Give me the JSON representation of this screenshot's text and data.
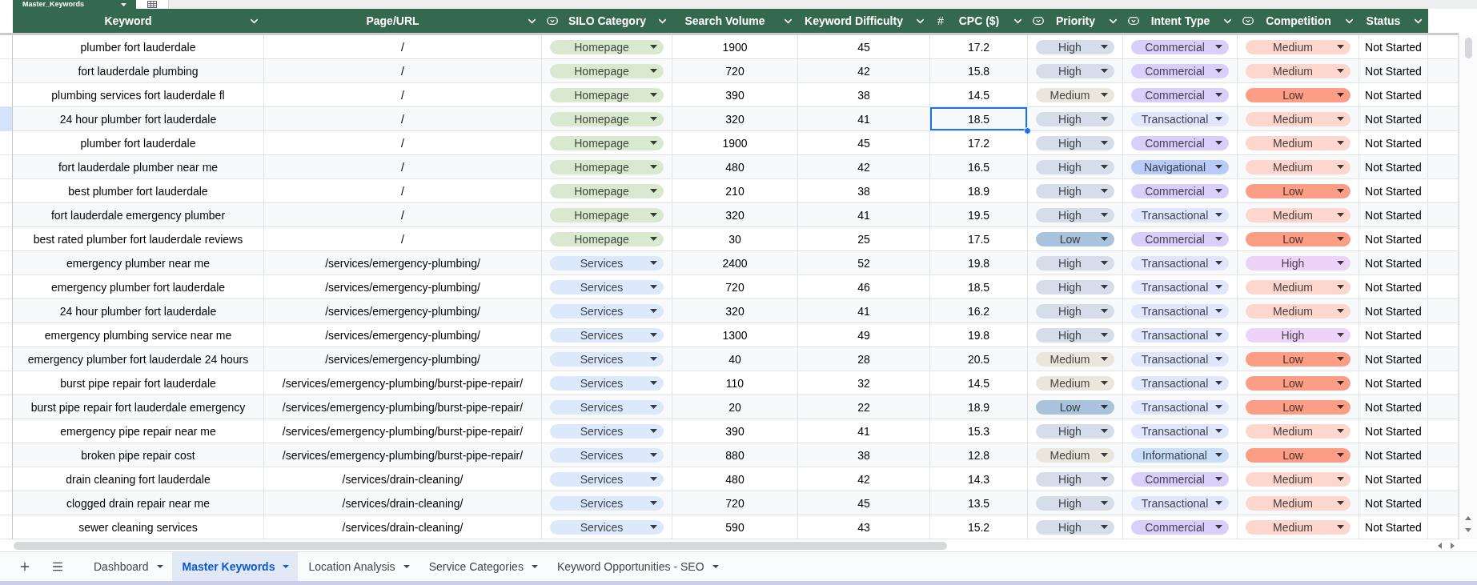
{
  "table_name": {
    "label": "Master_Keywords"
  },
  "columns": [
    {
      "label": "Keyword",
      "kind": "text",
      "selected": false
    },
    {
      "label": "Page/URL",
      "kind": "text",
      "selected": false
    },
    {
      "label": "SILO Category",
      "kind": "dropdown",
      "selected": false
    },
    {
      "label": "Search Volume",
      "kind": "text",
      "selected": false
    },
    {
      "label": "Keyword Difficulty",
      "kind": "text",
      "selected": false
    },
    {
      "label": "CPC ($)",
      "kind": "number",
      "symbol": "#",
      "selected": true
    },
    {
      "label": "Priority",
      "kind": "dropdown",
      "selected": false
    },
    {
      "label": "Intent Type",
      "kind": "dropdown",
      "selected": false
    },
    {
      "label": "Competition",
      "kind": "dropdown",
      "selected": false
    },
    {
      "label": "Status",
      "kind": "text",
      "selected": false
    }
  ],
  "rows": [
    {
      "selected": false,
      "cells": [
        "plumber fort lauderdale",
        "/",
        {
          "label": "Homepage",
          "color": "#d9e9cf"
        },
        "1900",
        "45",
        "17.2",
        {
          "label": "High",
          "color": "#d4dde9"
        },
        {
          "label": "Commercial",
          "color": "#d9cffb"
        },
        {
          "label": "Medium",
          "color": "#fdd6cd"
        },
        "Not Started"
      ]
    },
    {
      "selected": false,
      "cells": [
        "fort lauderdale plumbing",
        "/",
        {
          "label": "Homepage",
          "color": "#d9e9cf"
        },
        "720",
        "42",
        "15.8",
        {
          "label": "High",
          "color": "#d4dde9"
        },
        {
          "label": "Commercial",
          "color": "#d9cffb"
        },
        {
          "label": "Medium",
          "color": "#fdd6cd"
        },
        "Not Started"
      ]
    },
    {
      "selected": false,
      "cells": [
        "plumbing services fort lauderdale fl",
        "/",
        {
          "label": "Homepage",
          "color": "#d9e9cf"
        },
        "390",
        "38",
        "14.5",
        {
          "label": "Medium",
          "color": "#ebe6dc"
        },
        {
          "label": "Commercial",
          "color": "#d9cffb"
        },
        {
          "label": "Low",
          "color": "#fc9d86"
        },
        "Not Started"
      ]
    },
    {
      "selected": true,
      "cells": [
        "24 hour plumber fort lauderdale",
        "/",
        {
          "label": "Homepage",
          "color": "#d9e9cf"
        },
        "320",
        "41",
        "18.5",
        {
          "label": "High",
          "color": "#d4dde9"
        },
        {
          "label": "Transactional",
          "color": "#dfe6fd"
        },
        {
          "label": "Medium",
          "color": "#fdd6cd"
        },
        "Not Started"
      ]
    },
    {
      "selected": false,
      "cells": [
        "plumber fort lauderdale",
        "/",
        {
          "label": "Homepage",
          "color": "#d9e9cf"
        },
        "1900",
        "45",
        "17.2",
        {
          "label": "High",
          "color": "#d4dde9"
        },
        {
          "label": "Commercial",
          "color": "#d9cffb"
        },
        {
          "label": "Medium",
          "color": "#fdd6cd"
        },
        "Not Started"
      ]
    },
    {
      "selected": false,
      "cells": [
        "fort lauderdale plumber near me",
        "/",
        {
          "label": "Homepage",
          "color": "#d9e9cf"
        },
        "480",
        "42",
        "16.5",
        {
          "label": "High",
          "color": "#d4dde9"
        },
        {
          "label": "Navigational",
          "color": "#b8cbf7"
        },
        {
          "label": "Medium",
          "color": "#fdd6cd"
        },
        "Not Started"
      ]
    },
    {
      "selected": false,
      "cells": [
        "best plumber fort lauderdale",
        "/",
        {
          "label": "Homepage",
          "color": "#d9e9cf"
        },
        "210",
        "38",
        "18.9",
        {
          "label": "High",
          "color": "#d4dde9"
        },
        {
          "label": "Commercial",
          "color": "#d9cffb"
        },
        {
          "label": "Low",
          "color": "#fc9d86"
        },
        "Not Started"
      ]
    },
    {
      "selected": false,
      "cells": [
        "fort lauderdale emergency plumber",
        "/",
        {
          "label": "Homepage",
          "color": "#d9e9cf"
        },
        "320",
        "41",
        "19.5",
        {
          "label": "High",
          "color": "#d4dde9"
        },
        {
          "label": "Transactional",
          "color": "#dfe6fd"
        },
        {
          "label": "Medium",
          "color": "#fdd6cd"
        },
        "Not Started"
      ]
    },
    {
      "selected": false,
      "cells": [
        "best rated plumber fort lauderdale reviews",
        "/",
        {
          "label": "Homepage",
          "color": "#d9e9cf"
        },
        "30",
        "25",
        "17.5",
        {
          "label": "Low",
          "color": "#a9c3dc"
        },
        {
          "label": "Commercial",
          "color": "#d9cffb"
        },
        {
          "label": "Low",
          "color": "#fc9d86"
        },
        "Not Started"
      ]
    },
    {
      "selected": false,
      "cells": [
        "emergency plumber near me",
        "/services/emergency-plumbing/",
        {
          "label": "Services",
          "color": "#dce8fb"
        },
        "2400",
        "52",
        "19.8",
        {
          "label": "High",
          "color": "#d4dde9"
        },
        {
          "label": "Transactional",
          "color": "#dfe6fd"
        },
        {
          "label": "High",
          "color": "#edd3f8"
        },
        "Not Started"
      ]
    },
    {
      "selected": false,
      "cells": [
        "emergency plumber fort lauderdale",
        "/services/emergency-plumbing/",
        {
          "label": "Services",
          "color": "#dce8fb"
        },
        "720",
        "46",
        "18.5",
        {
          "label": "High",
          "color": "#d4dde9"
        },
        {
          "label": "Transactional",
          "color": "#dfe6fd"
        },
        {
          "label": "Medium",
          "color": "#fdd6cd"
        },
        "Not Started"
      ]
    },
    {
      "selected": false,
      "cells": [
        "24 hour plumber fort lauderdale",
        "/services/emergency-plumbing/",
        {
          "label": "Services",
          "color": "#dce8fb"
        },
        "320",
        "41",
        "16.2",
        {
          "label": "High",
          "color": "#d4dde9"
        },
        {
          "label": "Transactional",
          "color": "#dfe6fd"
        },
        {
          "label": "Medium",
          "color": "#fdd6cd"
        },
        "Not Started"
      ]
    },
    {
      "selected": false,
      "cells": [
        "emergency plumbing service near me",
        "/services/emergency-plumbing/",
        {
          "label": "Services",
          "color": "#dce8fb"
        },
        "1300",
        "49",
        "19.8",
        {
          "label": "High",
          "color": "#d4dde9"
        },
        {
          "label": "Transactional",
          "color": "#dfe6fd"
        },
        {
          "label": "High",
          "color": "#edd3f8"
        },
        "Not Started"
      ]
    },
    {
      "selected": false,
      "cells": [
        "emergency plumber fort lauderdale 24 hours",
        "/services/emergency-plumbing/",
        {
          "label": "Services",
          "color": "#dce8fb"
        },
        "40",
        "28",
        "20.5",
        {
          "label": "Medium",
          "color": "#ebe6dc"
        },
        {
          "label": "Transactional",
          "color": "#dfe6fd"
        },
        {
          "label": "Low",
          "color": "#fc9d86"
        },
        "Not Started"
      ]
    },
    {
      "selected": false,
      "cells": [
        "burst pipe repair fort lauderdale",
        "/services/emergency-plumbing/burst-pipe-repair/",
        {
          "label": "Services",
          "color": "#dce8fb"
        },
        "110",
        "32",
        "14.5",
        {
          "label": "Medium",
          "color": "#ebe6dc"
        },
        {
          "label": "Transactional",
          "color": "#dfe6fd"
        },
        {
          "label": "Low",
          "color": "#fc9d86"
        },
        "Not Started"
      ]
    },
    {
      "selected": false,
      "cells": [
        "burst pipe repair fort lauderdale emergency",
        "/services/emergency-plumbing/burst-pipe-repair/",
        {
          "label": "Services",
          "color": "#dce8fb"
        },
        "20",
        "22",
        "18.9",
        {
          "label": "Low",
          "color": "#a9c3dc"
        },
        {
          "label": "Transactional",
          "color": "#dfe6fd"
        },
        {
          "label": "Low",
          "color": "#fc9d86"
        },
        "Not Started"
      ]
    },
    {
      "selected": false,
      "cells": [
        "emergency pipe repair near me",
        "/services/emergency-plumbing/burst-pipe-repair/",
        {
          "label": "Services",
          "color": "#dce8fb"
        },
        "390",
        "41",
        "15.3",
        {
          "label": "High",
          "color": "#d4dde9"
        },
        {
          "label": "Transactional",
          "color": "#dfe6fd"
        },
        {
          "label": "Medium",
          "color": "#fdd6cd"
        },
        "Not Started"
      ]
    },
    {
      "selected": false,
      "cells": [
        "broken pipe repair cost",
        "/services/emergency-plumbing/burst-pipe-repair/",
        {
          "label": "Services",
          "color": "#dce8fb"
        },
        "880",
        "38",
        "12.8",
        {
          "label": "Medium",
          "color": "#ebe6dc"
        },
        {
          "label": "Informational",
          "color": "#c8def9"
        },
        {
          "label": "Low",
          "color": "#fc9d86"
        },
        "Not Started"
      ]
    },
    {
      "selected": false,
      "cells": [
        "drain cleaning fort lauderdale",
        "/services/drain-cleaning/",
        {
          "label": "Services",
          "color": "#dce8fb"
        },
        "480",
        "42",
        "14.3",
        {
          "label": "High",
          "color": "#d4dde9"
        },
        {
          "label": "Commercial",
          "color": "#d9cffb"
        },
        {
          "label": "Medium",
          "color": "#fdd6cd"
        },
        "Not Started"
      ]
    },
    {
      "selected": false,
      "cells": [
        "clogged drain repair near me",
        "/services/drain-cleaning/",
        {
          "label": "Services",
          "color": "#dce8fb"
        },
        "720",
        "45",
        "13.5",
        {
          "label": "High",
          "color": "#d4dde9"
        },
        {
          "label": "Transactional",
          "color": "#dfe6fd"
        },
        {
          "label": "Medium",
          "color": "#fdd6cd"
        },
        "Not Started"
      ]
    },
    {
      "selected": false,
      "cells": [
        "sewer cleaning services",
        "/services/drain-cleaning/",
        {
          "label": "Services",
          "color": "#dce8fb"
        },
        "590",
        "43",
        "15.2",
        {
          "label": "High",
          "color": "#d4dde9"
        },
        {
          "label": "Commercial",
          "color": "#d9cffb"
        },
        {
          "label": "Medium",
          "color": "#fdd6cd"
        },
        "Not Started"
      ]
    }
  ],
  "sheet_tabs": [
    {
      "label": "Dashboard",
      "selected": false
    },
    {
      "label": "Master Keywords",
      "selected": true
    },
    {
      "label": "Location Analysis",
      "selected": false
    },
    {
      "label": "Service Categories",
      "selected": false
    },
    {
      "label": "Keyword Opportunities - SEO",
      "selected": false
    }
  ]
}
